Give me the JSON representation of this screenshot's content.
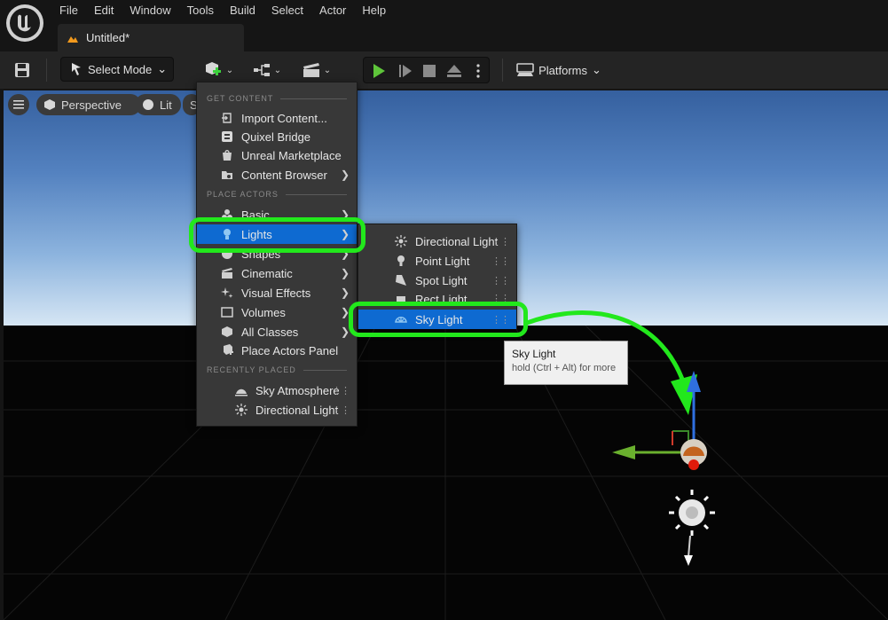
{
  "menubar": {
    "items": [
      "File",
      "Edit",
      "Window",
      "Tools",
      "Build",
      "Select",
      "Actor",
      "Help"
    ]
  },
  "document_tab": {
    "title": "Untitled*"
  },
  "toolbar": {
    "select_mode_label": "Select Mode",
    "platforms_label": "Platforms",
    "icons": [
      "save-icon",
      "add-actor-icon",
      "blueprint-icon",
      "cinematics-icon",
      "play-icon",
      "advance-frame-icon",
      "stop-icon",
      "eject-icon",
      "more-options-icon",
      "platforms-icon"
    ]
  },
  "viewport": {
    "perspective_label": "Perspective",
    "lit_label": "Lit",
    "extra_label": "S"
  },
  "add_menu": {
    "get_content_header": "GET CONTENT",
    "get_content": [
      {
        "label": "Import Content...",
        "icon": "import-icon"
      },
      {
        "label": "Quixel Bridge",
        "icon": "bridge-icon"
      },
      {
        "label": "Unreal Marketplace",
        "icon": "marketplace-icon"
      },
      {
        "label": "Content Browser",
        "icon": "folder-icon"
      }
    ],
    "place_actors_header": "PLACE ACTORS",
    "place_actors": [
      {
        "label": "Basic",
        "icon": "basic-shapes-icon"
      },
      {
        "label": "Lights",
        "icon": "lightbulb-icon"
      },
      {
        "label": "Shapes",
        "icon": "shapes-icon"
      },
      {
        "label": "Cinematic",
        "icon": "clapper-icon"
      },
      {
        "label": "Visual Effects",
        "icon": "sparkle-icon"
      },
      {
        "label": "Volumes",
        "icon": "volume-icon"
      },
      {
        "label": "All Classes",
        "icon": "classes-icon"
      },
      {
        "label": "Place Actors Panel",
        "icon": "place-actors-icon"
      }
    ],
    "recently_placed_header": "RECENTLY PLACED",
    "recently_placed": [
      {
        "label": "Sky Atmosphere",
        "icon": "sky-atmosphere-icon"
      },
      {
        "label": "Directional Light",
        "icon": "directional-light-icon"
      }
    ]
  },
  "lights_menu": {
    "items": [
      {
        "label": "Directional Light",
        "icon": "directional-light-icon"
      },
      {
        "label": "Point Light",
        "icon": "point-light-icon"
      },
      {
        "label": "Spot Light",
        "icon": "spot-light-icon"
      },
      {
        "label": "Rect Light",
        "icon": "rect-light-icon"
      },
      {
        "label": "Sky Light",
        "icon": "sky-light-icon"
      }
    ]
  },
  "tooltip": {
    "title": "Sky Light",
    "hint": "hold (Ctrl + Alt) for more"
  },
  "colors": {
    "accent_selected": "#0e6ad1",
    "annotation_green": "#22e81c",
    "menu_bg": "#383838"
  }
}
